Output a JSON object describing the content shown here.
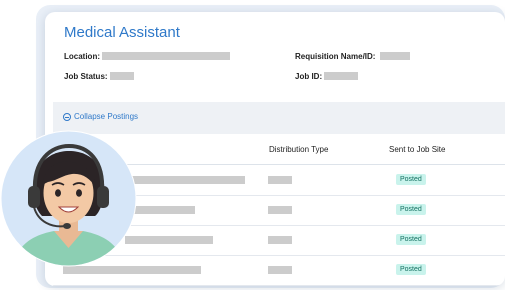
{
  "job": {
    "title": "Medical Assistant",
    "location_label": "Location:",
    "status_label": "Job Status:",
    "requisition_label": "Requisition Name/ID:",
    "jobid_label": "Job ID:"
  },
  "postings": {
    "collapse_label": "Collapse Postings",
    "columns": [
      "Distribution Type",
      "Sent to Job Site"
    ],
    "rows": [
      {
        "status": "Posted"
      },
      {
        "status": "Posted"
      },
      {
        "status": "Posted"
      },
      {
        "status": "Posted"
      }
    ]
  },
  "colors": {
    "accent": "#2f79c9",
    "badge_bg": "#c9f3ec",
    "badge_text": "#137060",
    "redaction": "#cccccc",
    "avatar_bg": "#d6e6f8"
  },
  "icons": [
    "minus-circle-icon",
    "support-agent-avatar"
  ]
}
